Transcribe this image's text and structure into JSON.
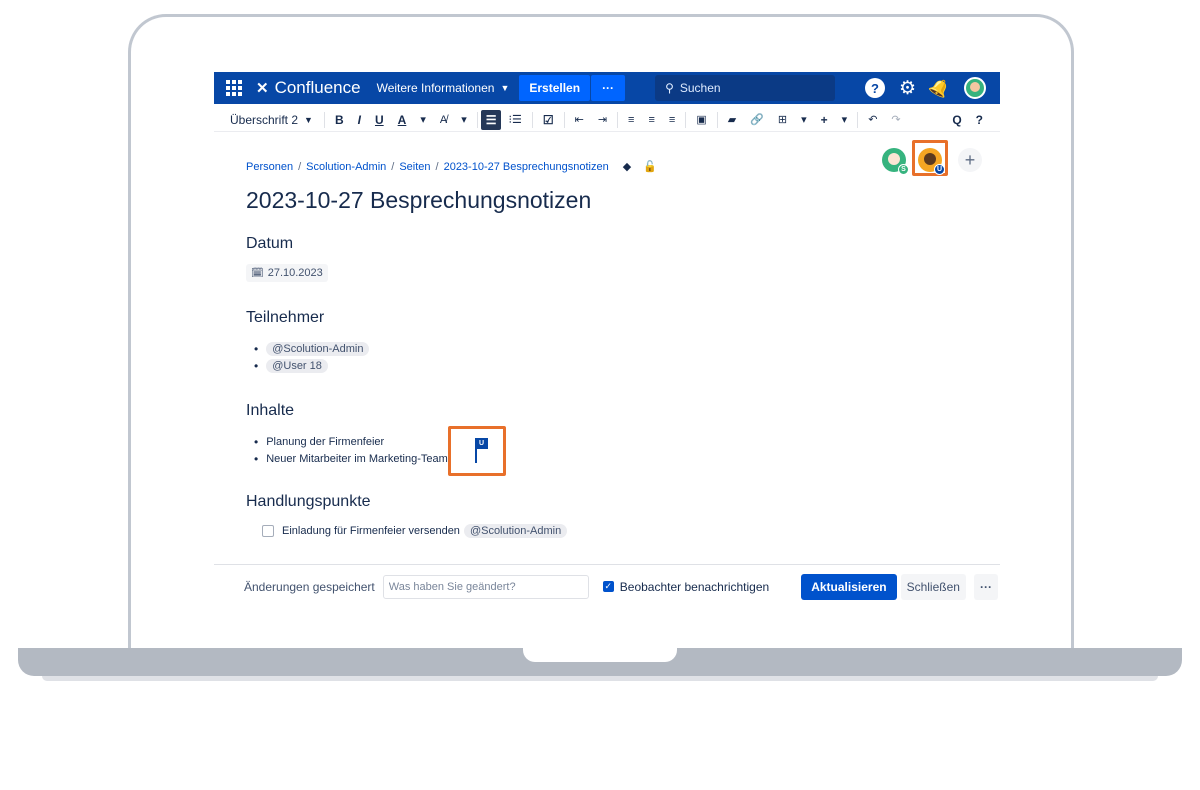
{
  "topnav": {
    "product": "Confluence",
    "more_info": "Weitere Informationen",
    "create": "Erstellen",
    "create_more": "···",
    "search_placeholder": "Suchen",
    "help": "?"
  },
  "toolbar": {
    "style": "Überschrift 2",
    "bold": "B",
    "italic": "I",
    "underline": "U",
    "text_color": "A",
    "clear_format": "A̸",
    "bullet_list": "☰",
    "numbered_list": "⁝☰",
    "task": "☑",
    "outdent": "⇤",
    "indent": "⇥",
    "align_left": "≡",
    "align_center": "≡",
    "align_right": "≡",
    "layout": "▣",
    "image": "▰",
    "link": "🔗",
    "table": "⊞",
    "insert": "+",
    "undo": "↶",
    "redo": "↷",
    "find": "Q",
    "help": "?"
  },
  "breadcrumb": [
    "Personen",
    "Scolution-Admin",
    "Seiten",
    "2023-10-27 Besprechungsnotizen"
  ],
  "collaborators": [
    {
      "initial": "S",
      "color": "#36b37e"
    },
    {
      "initial": "U",
      "color": "#0747a6"
    }
  ],
  "add_collaborator": "+",
  "page": {
    "title": "2023-10-27 Besprechungsnotizen",
    "sections": {
      "date_heading": "Datum",
      "date_value": "27.10.2023",
      "participants_heading": "Teilnehmer",
      "participants": [
        "@Scolution-Admin",
        "@User 18"
      ],
      "content_heading": "Inhalte",
      "content_items": [
        "Planung der Firmenfeier",
        "Neuer Mitarbeiter im Marketing-Team"
      ],
      "actions_heading": "Handlungspunkte",
      "action_text": "Einladung für Firmenfeier versenden",
      "action_mention": "@Scolution-Admin"
    },
    "cursor_label": "U"
  },
  "footer": {
    "saved": "Änderungen gespeichert",
    "change_placeholder": "Was haben Sie geändert?",
    "notify_watchers": "Beobachter benachrichtigen",
    "update": "Aktualisieren",
    "close": "Schließen",
    "more": "···"
  },
  "colors": {
    "nav": "#0747a6",
    "primary": "#0052cc",
    "highlight": "#e8702a"
  }
}
